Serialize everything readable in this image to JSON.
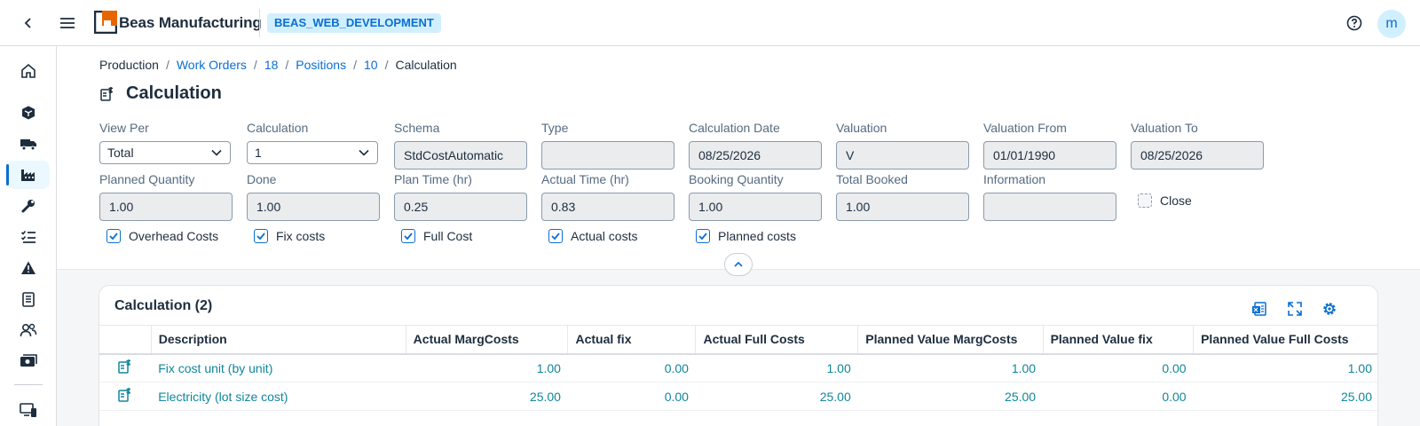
{
  "shell": {
    "app_title": "Beas Manufacturing",
    "system_badge": "BEAS_WEB_DEVELOPMENT",
    "avatar_initial": "m"
  },
  "sidenav": {
    "items": [
      {
        "icon": "home-icon"
      },
      {
        "icon": "cube-icon"
      },
      {
        "icon": "truck-icon"
      },
      {
        "icon": "factory-icon",
        "active": true
      },
      {
        "icon": "wrench-icon"
      },
      {
        "icon": "task-list-icon"
      },
      {
        "icon": "warning-icon"
      },
      {
        "icon": "clipboard-icon"
      },
      {
        "icon": "people-icon"
      },
      {
        "icon": "money-icon"
      },
      {
        "icon": "monitor-icon"
      }
    ]
  },
  "breadcrumb": {
    "items": [
      {
        "label": "Production",
        "link": false
      },
      {
        "label": "Work Orders",
        "link": true
      },
      {
        "label": "18",
        "link": true
      },
      {
        "label": "Positions",
        "link": true
      },
      {
        "label": "10",
        "link": true
      },
      {
        "label": "Calculation",
        "link": false
      }
    ],
    "separator": "/"
  },
  "page": {
    "title": "Calculation"
  },
  "form": {
    "view_per": {
      "label": "View Per",
      "value": "Total"
    },
    "calculation": {
      "label": "Calculation",
      "value": "1"
    },
    "schema": {
      "label": "Schema",
      "value": "StdCostAutomatic"
    },
    "type": {
      "label": "Type",
      "value": ""
    },
    "calculation_date": {
      "label": "Calculation Date",
      "value": "08/25/2026"
    },
    "valuation": {
      "label": "Valuation",
      "value": "V"
    },
    "valuation_from": {
      "label": "Valuation From",
      "value": "01/01/1990"
    },
    "valuation_to": {
      "label": "Valuation To",
      "value": "08/25/2026"
    },
    "planned_quantity": {
      "label": "Planned Quantity",
      "value": "1.00"
    },
    "done": {
      "label": "Done",
      "value": "1.00"
    },
    "plan_time": {
      "label": "Plan Time (hr)",
      "value": "0.25"
    },
    "actual_time": {
      "label": "Actual Time (hr)",
      "value": "0.83"
    },
    "booking_quantity": {
      "label": "Booking Quantity",
      "value": "1.00"
    },
    "total_booked": {
      "label": "Total Booked",
      "value": "1.00"
    },
    "information": {
      "label": "Information",
      "value": ""
    },
    "close": {
      "label": "Close",
      "checked": false
    }
  },
  "checkboxes": {
    "overhead_costs": {
      "label": "Overhead Costs",
      "checked": true
    },
    "fix_costs": {
      "label": "Fix costs",
      "checked": true
    },
    "full_cost": {
      "label": "Full Cost",
      "checked": true
    },
    "actual_costs": {
      "label": "Actual costs",
      "checked": true
    },
    "planned_costs": {
      "label": "Planned costs",
      "checked": true
    }
  },
  "table": {
    "title": "Calculation (2)",
    "columns": [
      "Description",
      "Actual MargCosts",
      "Actual fix",
      "Actual Full Costs",
      "Planned Value MargCosts",
      "Planned Value fix",
      "Planned Value Full Costs"
    ],
    "rows": [
      {
        "description": "Fix cost unit (by unit)",
        "actual_marg": "1.00",
        "actual_fix": "0.00",
        "actual_full": "1.00",
        "planned_marg": "1.00",
        "planned_fix": "0.00",
        "planned_full": "1.00"
      },
      {
        "description": "Electricity (lot size cost)",
        "actual_marg": "25.00",
        "actual_fix": "0.00",
        "actual_full": "25.00",
        "planned_marg": "25.00",
        "planned_fix": "0.00",
        "planned_full": "25.00"
      }
    ]
  },
  "colors": {
    "accent": "#0a6ed1",
    "link_teal": "#10869b",
    "logo_orange": "#e76500"
  }
}
